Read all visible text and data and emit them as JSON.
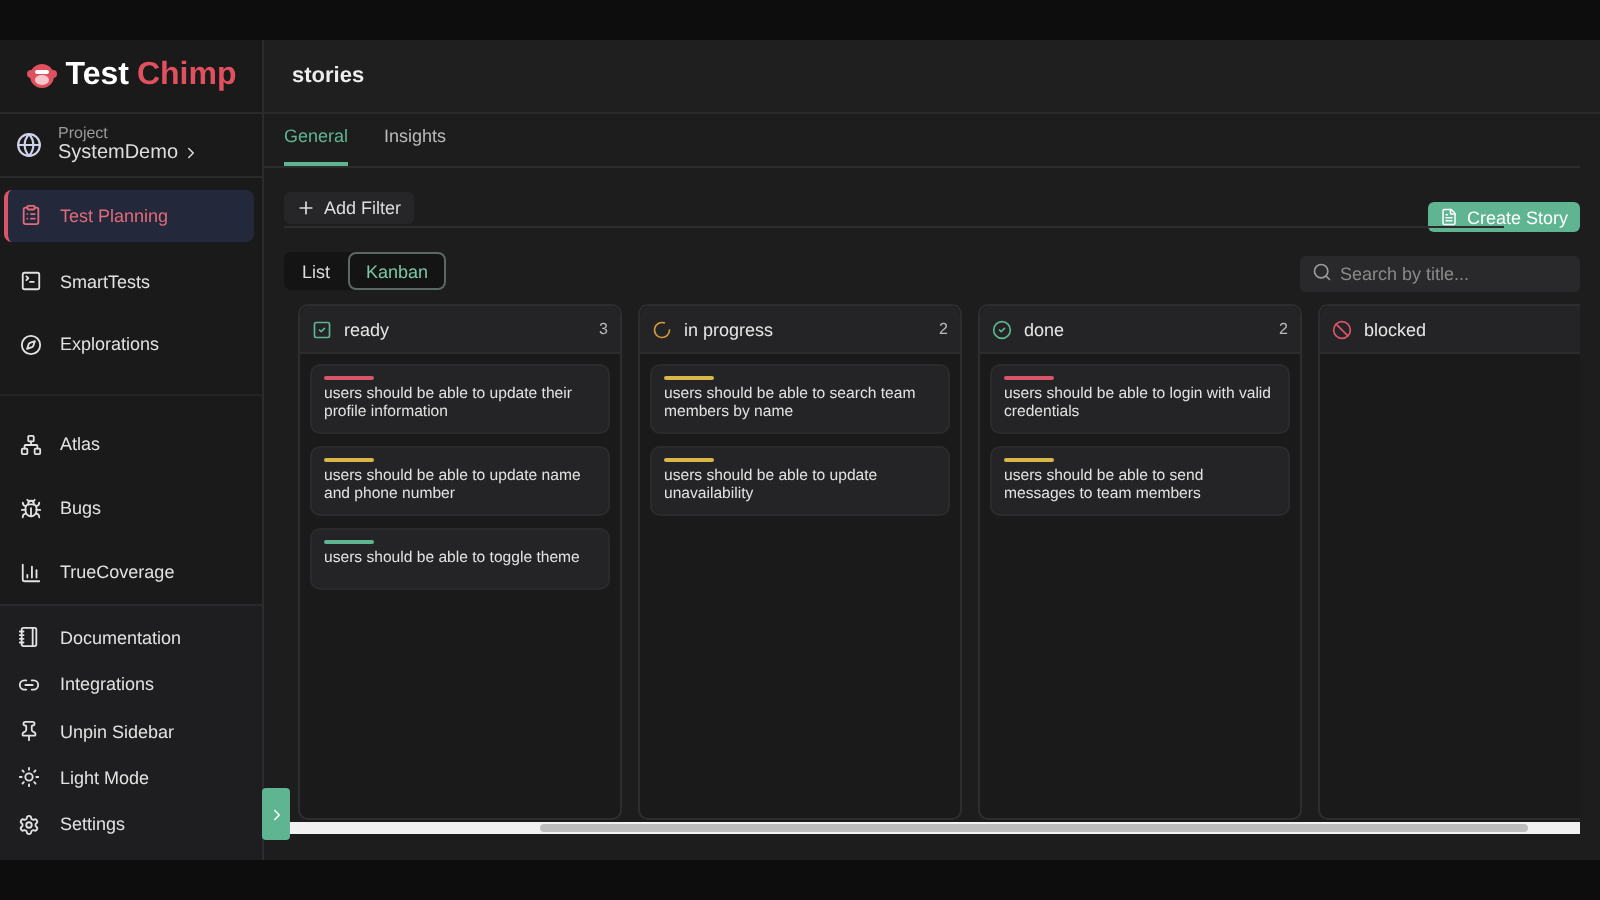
{
  "logo": {
    "first": "Test",
    "second": "Chimp"
  },
  "project": {
    "label": "Project",
    "name": "SystemDemo"
  },
  "nav": [
    {
      "label": "Test Planning",
      "selected": true
    },
    {
      "label": "SmartTests",
      "selected": false
    },
    {
      "label": "Explorations",
      "selected": false
    },
    {
      "label": "Atlas",
      "selected": false
    },
    {
      "label": "Bugs",
      "selected": false
    },
    {
      "label": "TrueCoverage",
      "selected": false
    }
  ],
  "footer_nav": [
    {
      "label": "Documentation"
    },
    {
      "label": "Integrations"
    },
    {
      "label": "Unpin Sidebar"
    },
    {
      "label": "Light Mode"
    },
    {
      "label": "Settings"
    }
  ],
  "page_title": "stories",
  "tabs": [
    {
      "label": "General",
      "selected": true
    },
    {
      "label": "Insights",
      "selected": false
    }
  ],
  "add_filter": "Add Filter",
  "create_story": "Create Story",
  "views": [
    {
      "label": "List",
      "selected": false
    },
    {
      "label": "Kanban",
      "selected": true
    }
  ],
  "search": {
    "placeholder": "Search by title..."
  },
  "columns": [
    {
      "title": "ready",
      "count": "3",
      "cards": [
        {
          "text": "users should be able to update their profile information",
          "color": "#d9556a"
        },
        {
          "text": "users should be able to update name and phone number",
          "color": "#d8b64a"
        },
        {
          "text": "users should be able to toggle theme",
          "color": "#5fb592"
        }
      ]
    },
    {
      "title": "in progress",
      "count": "2",
      "cards": [
        {
          "text": "users should be able to search team members by name",
          "color": "#d8b64a"
        },
        {
          "text": "users should be able to update unavailability",
          "color": "#d8b64a"
        }
      ]
    },
    {
      "title": "done",
      "count": "2",
      "cards": [
        {
          "text": "users should be able to login with valid credentials",
          "color": "#d9556a"
        },
        {
          "text": "users should be able to send messages to team members",
          "color": "#d8b64a"
        }
      ]
    },
    {
      "title": "blocked"
    }
  ]
}
